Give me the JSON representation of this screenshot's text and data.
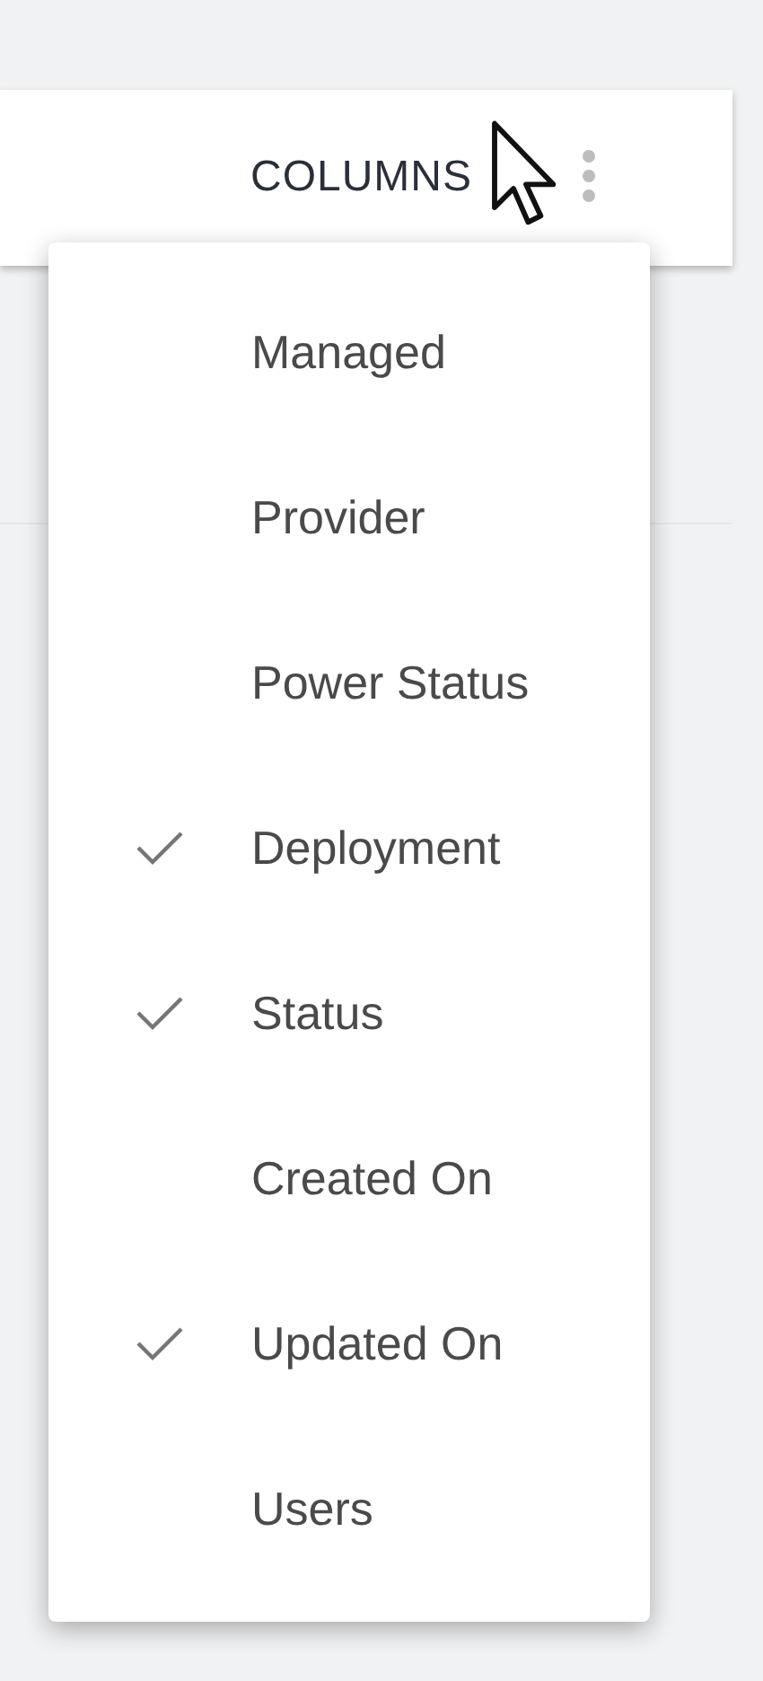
{
  "toolbar": {
    "columns_button": "COLUMNS"
  },
  "menu": {
    "items": [
      {
        "label": "Managed",
        "checked": false
      },
      {
        "label": "Provider",
        "checked": false
      },
      {
        "label": "Power Status",
        "checked": false
      },
      {
        "label": "Deployment",
        "checked": true
      },
      {
        "label": "Status",
        "checked": true
      },
      {
        "label": "Created On",
        "checked": false
      },
      {
        "label": "Updated On",
        "checked": true
      },
      {
        "label": "Users",
        "checked": false
      }
    ]
  }
}
